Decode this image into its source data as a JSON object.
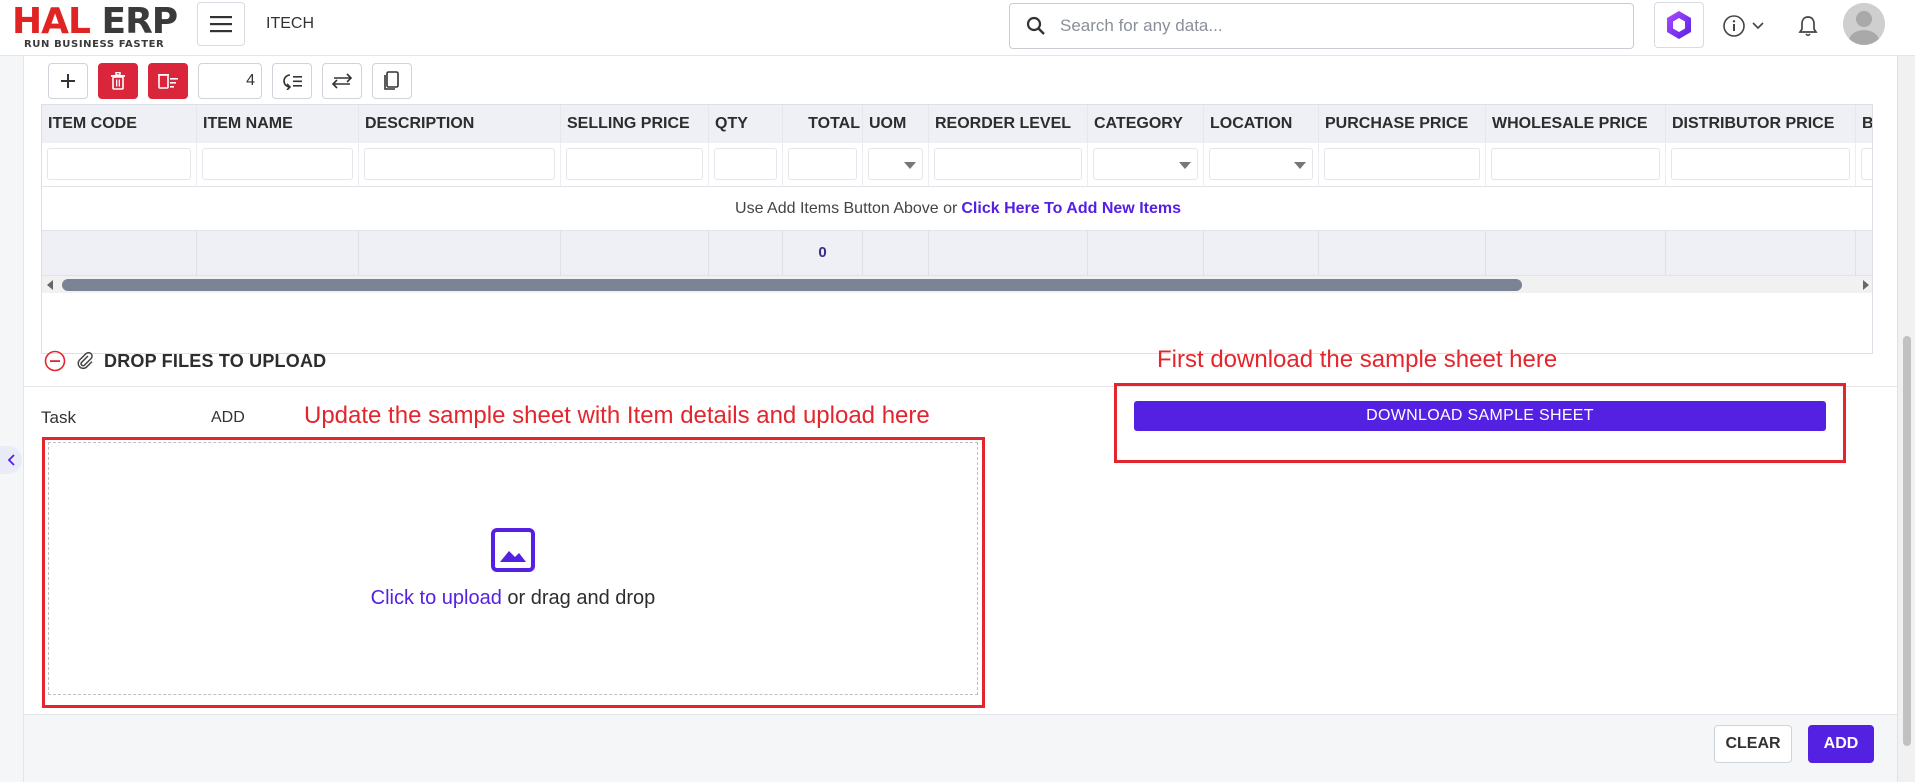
{
  "brand": {
    "logo_main": "HAL",
    "logo_erp": "ERP",
    "logo_tagline": "RUN BUSINESS FASTER",
    "accent": "#5421e3",
    "danger": "#d9263b"
  },
  "header": {
    "company": "ITECH",
    "search_placeholder": "Search for any data..."
  },
  "toolbar": {
    "row_count": "4"
  },
  "grid": {
    "columns": [
      "ITEM CODE",
      "ITEM NAME",
      "DESCRIPTION",
      "SELLING PRICE",
      "QTY",
      "TOTAL",
      "UOM",
      "REORDER LEVEL",
      "CATEGORY",
      "LOCATION",
      "PURCHASE PRICE",
      "WHOLESALE PRICE",
      "DISTRIBUTOR PRICE",
      "B"
    ],
    "empty_message": "Use Add Items Button Above or",
    "empty_link": "Click Here To Add New Items",
    "total_value": "0"
  },
  "upload": {
    "section_title": "DROP FILES TO UPLOAD",
    "task_label": "Task",
    "task_value": "ADD",
    "click_to_upload": "Click to upload",
    "drag_text": "or drag and drop",
    "download_button": "DOWNLOAD SAMPLE SHEET"
  },
  "annotations": {
    "upload_hint": "Update the sample sheet with Item details and upload here",
    "download_hint": "First download the sample sheet here"
  },
  "footer": {
    "clear_label": "CLEAR",
    "add_label": "ADD"
  }
}
